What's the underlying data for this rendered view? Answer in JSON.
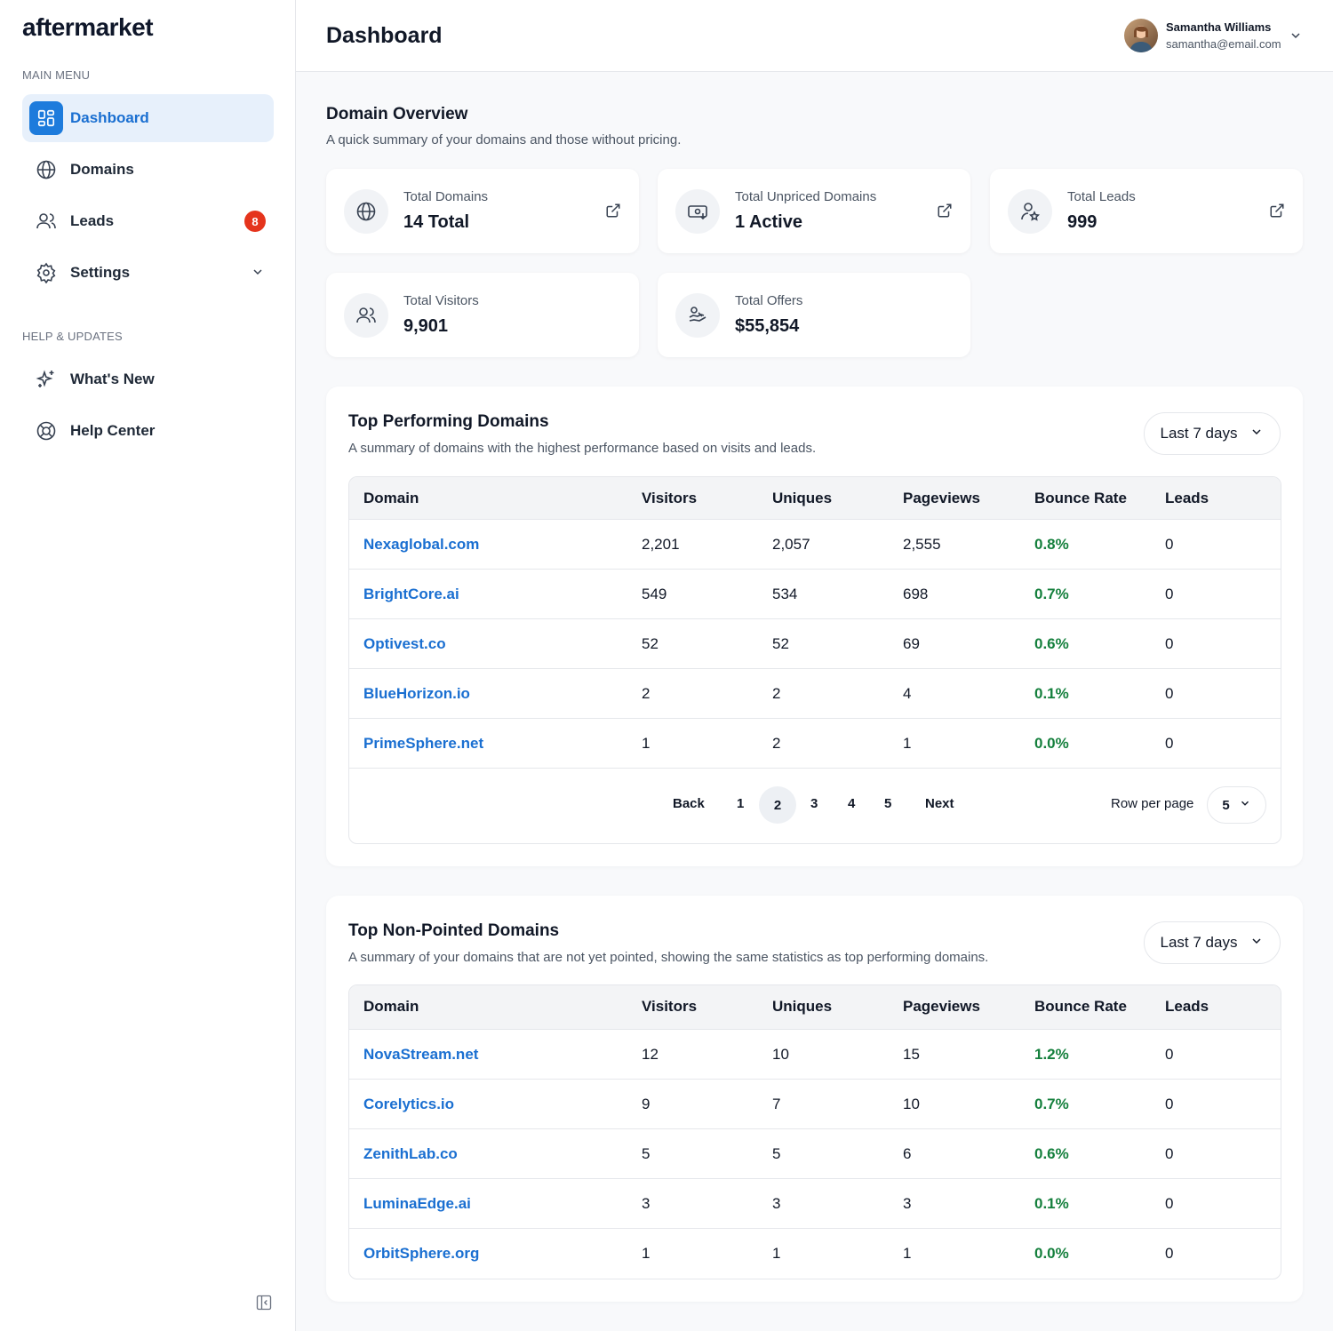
{
  "app": {
    "logo": "aftermarket"
  },
  "sidebar": {
    "main_menu_label": "MAIN MENU",
    "help_label": "HELP & UPDATES",
    "items": [
      {
        "label": "Dashboard",
        "icon": "dashboard-icon",
        "active": true
      },
      {
        "label": "Domains",
        "icon": "globe-icon"
      },
      {
        "label": "Leads",
        "icon": "users-icon",
        "badge": "8"
      },
      {
        "label": "Settings",
        "icon": "gear-icon"
      }
    ],
    "help_items": [
      {
        "label": "What's New",
        "icon": "sparkles-icon"
      },
      {
        "label": "Help Center",
        "icon": "lifebuoy-icon"
      }
    ]
  },
  "header": {
    "title": "Dashboard",
    "user": {
      "name": "Samantha Williams",
      "email": "samantha@email.com"
    }
  },
  "overview": {
    "title": "Domain Overview",
    "subtitle": "A quick summary of your domains and those without pricing.",
    "cards": [
      {
        "label": "Total Domains",
        "value": "14 Total"
      },
      {
        "label": "Total Unpriced Domains",
        "value": "1 Active"
      },
      {
        "label": "Total Leads",
        "value": "999"
      },
      {
        "label": "Total Visitors",
        "value": "9,901"
      },
      {
        "label": "Total Offers",
        "value": "$55,854"
      }
    ]
  },
  "columns": [
    "Domain",
    "Visitors",
    "Uniques",
    "Pageviews",
    "Bounce Rate",
    "Leads"
  ],
  "top_performing": {
    "title": "Top Performing Domains",
    "subtitle": "A summary of domains with the highest performance based on visits and leads.",
    "range": "Last 7 days",
    "rows": [
      [
        "Nexaglobal.com",
        "2,201",
        "2,057",
        "2,555",
        "0.8%",
        "0"
      ],
      [
        "BrightCore.ai",
        "549",
        "534",
        "698",
        "0.7%",
        "0"
      ],
      [
        "Optivest.co",
        "52",
        "52",
        "69",
        "0.6%",
        "0"
      ],
      [
        "BlueHorizon.io",
        "2",
        "2",
        "4",
        "0.1%",
        "0"
      ],
      [
        "PrimeSphere.net",
        "1",
        "2",
        "1",
        "0.0%",
        "0"
      ]
    ],
    "pagination": {
      "back": "Back",
      "pages": [
        "1",
        "2",
        "3",
        "4",
        "5"
      ],
      "current": "2",
      "next": "Next",
      "rows_per_page_label": "Row per page",
      "rows_per_page": "5"
    }
  },
  "non_pointed": {
    "title": "Top Non-Pointed Domains",
    "subtitle": "A summary of your domains that are not yet pointed, showing the same statistics as top performing domains.",
    "range": "Last 7 days",
    "rows": [
      [
        "NovaStream.net",
        "12",
        "10",
        "15",
        "1.2%",
        "0"
      ],
      [
        "Corelytics.io",
        "9",
        "7",
        "10",
        "0.7%",
        "0"
      ],
      [
        "ZenithLab.co",
        "5",
        "5",
        "6",
        "0.6%",
        "0"
      ],
      [
        "LuminaEdge.ai",
        "3",
        "3",
        "3",
        "0.1%",
        "0"
      ],
      [
        "OrbitSphere.org",
        "1",
        "1",
        "1",
        "0.0%",
        "0"
      ]
    ]
  },
  "colors": {
    "accent": "#1a6fd1",
    "badge": "#e5341c",
    "rate": "#15803d"
  }
}
